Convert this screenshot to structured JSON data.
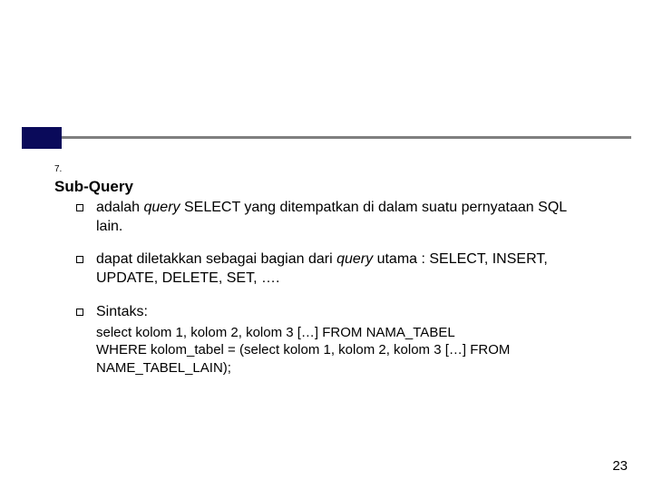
{
  "listNumber": "7.",
  "title": "Sub-Query",
  "bullets": [
    {
      "parts": [
        {
          "text": "adalah ",
          "italic": false
        },
        {
          "text": "query",
          "italic": true
        },
        {
          "text": " SELECT yang ditempatkan di dalam suatu pernyataan SQL lain.",
          "italic": false
        }
      ]
    },
    {
      "parts": [
        {
          "text": "dapat diletakkan sebagai bagian dari ",
          "italic": false
        },
        {
          "text": "query",
          "italic": true
        },
        {
          "text": " utama : SELECT, INSERT, UPDATE, DELETE, SET, ….",
          "italic": false
        }
      ]
    },
    {
      "parts": [
        {
          "text": "Sintaks:",
          "italic": false
        }
      ]
    }
  ],
  "syntax": [
    "select kolom 1, kolom 2, kolom 3 […] FROM NAMA_TABEL",
    "WHERE kolom_tabel = (select kolom 1, kolom 2, kolom 3 […] FROM",
    "NAME_TABEL_LAIN);"
  ],
  "pageNumber": "23"
}
